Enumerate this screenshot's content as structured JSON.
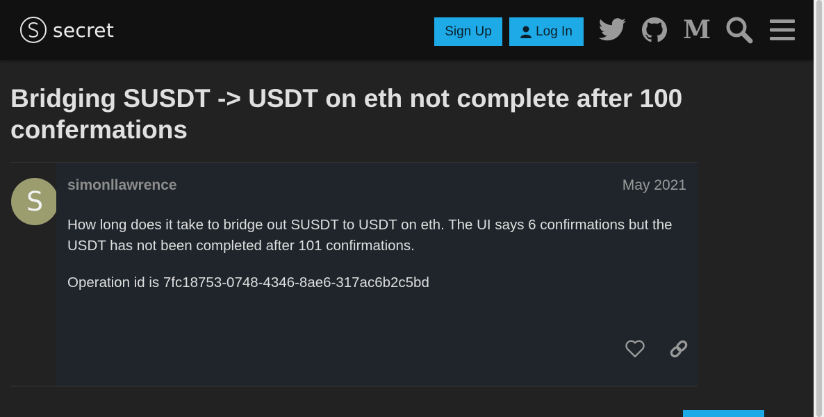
{
  "header": {
    "logo_text": "secret",
    "signup_label": "Sign Up",
    "login_label": "Log In",
    "icons": [
      "twitter-icon",
      "github-icon",
      "medium-icon",
      "search-icon",
      "hamburger-menu-icon"
    ]
  },
  "topic": {
    "title": "Bridging SUSDT -> USDT on eth not complete after 100 confermations"
  },
  "post": {
    "avatar_letter": "S",
    "username": "simonllawrence",
    "date": "May 2021",
    "paragraphs": [
      "How long does it take to bridge out SUSDT to USDT on eth. The UI says 6 confirmations but the USDT has not been completed after 101 confirmations.",
      "Operation id is 7fc18753-0748-4346-8ae6-317ac6b2c5bd"
    ],
    "actions": [
      "heart-icon",
      "link-icon"
    ]
  },
  "colors": {
    "accent": "#1eaae7",
    "header_bg": "#111111",
    "page_bg": "#222222",
    "post_bg": "#1f252b",
    "avatar_bg": "#9b9d6e"
  }
}
